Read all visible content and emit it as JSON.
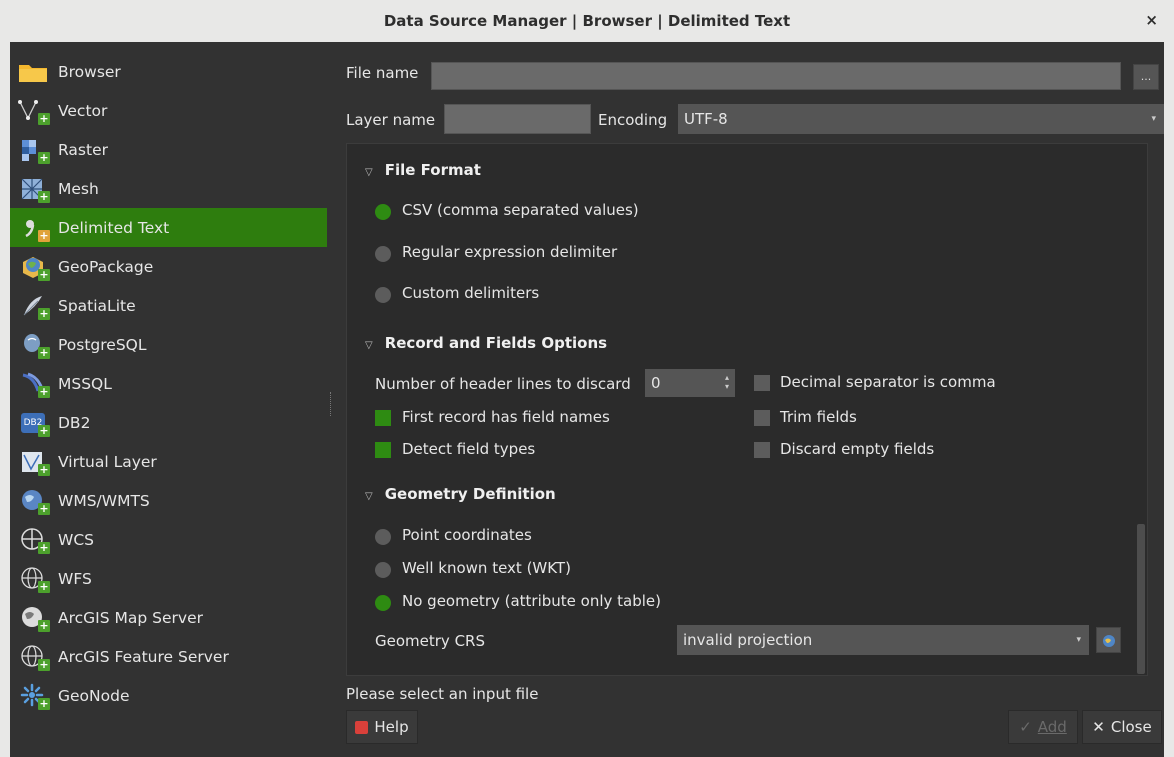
{
  "window": {
    "title": "Data Source Manager | Browser | Delimited Text",
    "close_glyph": "×"
  },
  "sidebar": {
    "items": [
      {
        "label": "Browser",
        "icon": "folder-icon"
      },
      {
        "label": "Vector",
        "icon": "vector-icon"
      },
      {
        "label": "Raster",
        "icon": "raster-icon"
      },
      {
        "label": "Mesh",
        "icon": "mesh-icon"
      },
      {
        "label": "Delimited Text",
        "icon": "delimited-text-icon"
      },
      {
        "label": "GeoPackage",
        "icon": "geopackage-icon"
      },
      {
        "label": "SpatiaLite",
        "icon": "spatialite-icon"
      },
      {
        "label": "PostgreSQL",
        "icon": "postgresql-icon"
      },
      {
        "label": "MSSQL",
        "icon": "mssql-icon"
      },
      {
        "label": "DB2",
        "icon": "db2-icon"
      },
      {
        "label": "Virtual Layer",
        "icon": "virtual-layer-icon"
      },
      {
        "label": "WMS/WMTS",
        "icon": "wms-icon"
      },
      {
        "label": "WCS",
        "icon": "wcs-icon"
      },
      {
        "label": "WFS",
        "icon": "wfs-icon"
      },
      {
        "label": "ArcGIS Map Server",
        "icon": "arcgis-map-server-icon"
      },
      {
        "label": "ArcGIS Feature Server",
        "icon": "arcgis-feature-server-icon"
      },
      {
        "label": "GeoNode",
        "icon": "geonode-icon"
      }
    ],
    "active_index": 4,
    "db2_badge": "DB2"
  },
  "form": {
    "file_name_label": "File name",
    "file_name_value": "",
    "browse_label": "...",
    "layer_name_label": "Layer name",
    "layer_name_value": "",
    "encoding_label": "Encoding",
    "encoding_value": "UTF-8"
  },
  "file_format": {
    "title": "File Format",
    "options": [
      {
        "label": "CSV (comma separated values)",
        "checked": true
      },
      {
        "label": "Regular expression delimiter",
        "checked": false
      },
      {
        "label": "Custom delimiters",
        "checked": false
      }
    ]
  },
  "record_options": {
    "title": "Record and Fields Options",
    "header_lines_label": "Number of header lines to discard",
    "header_lines_value": "0",
    "first_record": {
      "label": "First record has field names",
      "checked": true
    },
    "detect_types": {
      "label": "Detect field types",
      "checked": true
    },
    "decimal_comma": {
      "label": "Decimal separator is comma",
      "checked": false
    },
    "trim_fields": {
      "label": "Trim fields",
      "checked": false
    },
    "discard_empty": {
      "label": "Discard empty fields",
      "checked": false
    }
  },
  "geometry": {
    "title": "Geometry Definition",
    "options": [
      {
        "label": "Point coordinates",
        "checked": false
      },
      {
        "label": "Well known text (WKT)",
        "checked": false
      },
      {
        "label": "No geometry (attribute only table)",
        "checked": true
      }
    ],
    "crs_label": "Geometry CRS",
    "crs_value": "invalid projection"
  },
  "status_text": "Please select an input file",
  "buttons": {
    "help": "Help",
    "add": "Add",
    "close": "Close",
    "add_check": "✓",
    "close_x": "✕"
  },
  "colors": {
    "accent": "#2e7d0e",
    "background": "#323232",
    "panel": "#2b2b2b"
  }
}
